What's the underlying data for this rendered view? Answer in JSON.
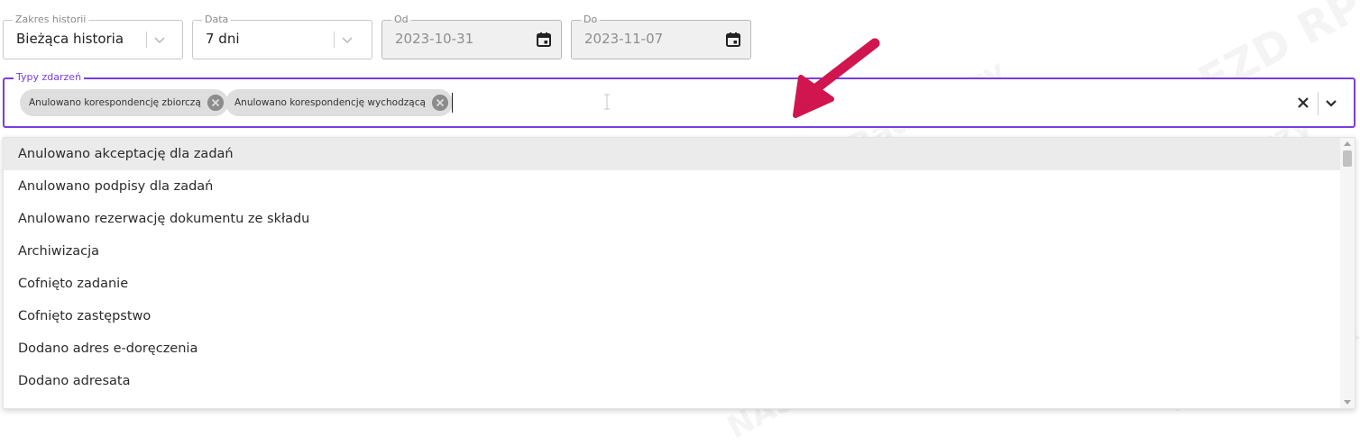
{
  "filters": {
    "history": {
      "label": "Zakres historii",
      "value": "Bieżąca historia"
    },
    "period": {
      "label": "Data",
      "value": "7 dni"
    },
    "from": {
      "label": "Od",
      "value": "2023-10-31"
    },
    "to": {
      "label": "Do",
      "value": "2023-11-07"
    }
  },
  "event_types": {
    "label": "Typy zdarzeń",
    "chips": [
      "Anulowano korespondencję zbiorczą",
      "Anulowano korespondencję wychodzącą"
    ]
  },
  "dropdown": {
    "options": [
      "Anulowano akceptację dla zadań",
      "Anulowano podpisy dla zadań",
      "Anulowano rezerwację dokumentu ze składu",
      "Archiwizacja",
      "Cofnięto zadanie",
      "Cofnięto zastępstwo",
      "Dodano adres e-doręczenia",
      "Dodano adresata"
    ],
    "highlighted_index": 0
  },
  "watermark": {
    "lines": [
      "NASK – Państwowy Instytut Badawczy",
      "EZD RP",
      "NASK"
    ]
  },
  "colors": {
    "accent": "#7a3de0",
    "arrow": "#d0154f"
  }
}
